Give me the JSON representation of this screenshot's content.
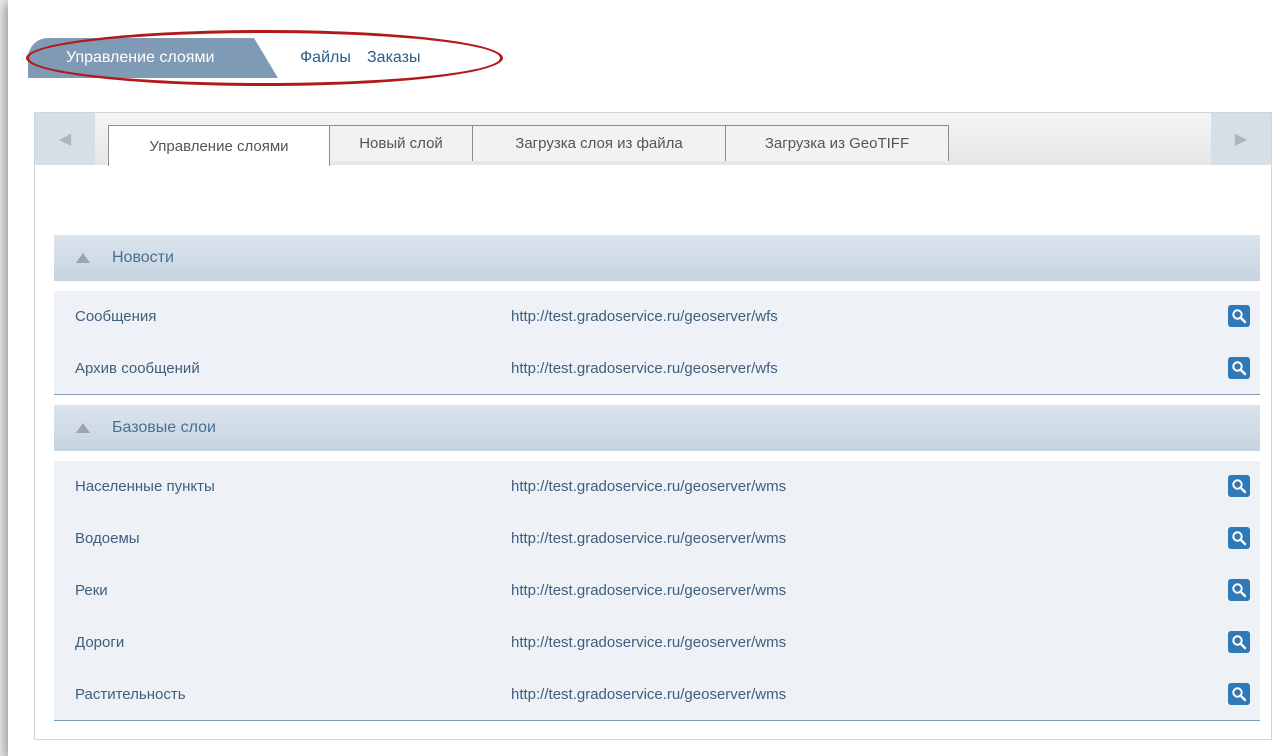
{
  "topnav": {
    "active": "Управление слоями",
    "links": [
      "Файлы",
      "Заказы"
    ]
  },
  "tabs": [
    "Управление слоями",
    "Новый слой",
    "Загрузка слоя из файла",
    "Загрузка из GeoTIFF"
  ],
  "sections": [
    {
      "title": "Новости",
      "rows": [
        {
          "name": "Сообщения",
          "url": "http://test.gradoservice.ru/geoserver/wfs"
        },
        {
          "name": "Архив сообщений",
          "url": "http://test.gradoservice.ru/geoserver/wfs"
        }
      ]
    },
    {
      "title": "Базовые слои",
      "rows": [
        {
          "name": "Населенные пункты",
          "url": "http://test.gradoservice.ru/geoserver/wms"
        },
        {
          "name": "Водоемы",
          "url": "http://test.gradoservice.ru/geoserver/wms"
        },
        {
          "name": "Реки",
          "url": "http://test.gradoservice.ru/geoserver/wms"
        },
        {
          "name": "Дороги",
          "url": "http://test.gradoservice.ru/geoserver/wms"
        },
        {
          "name": "Растительность",
          "url": "http://test.gradoservice.ru/geoserver/wms"
        }
      ]
    }
  ],
  "icons": {
    "tab_prev": "arrow-left-icon",
    "tab_next": "arrow-right-icon",
    "section_toggle": "triangle-up-icon",
    "row_action": "search-icon"
  },
  "colors": {
    "active_tab_bg": "#7f9ab5",
    "highlight_oval": "#b21a1a",
    "link": "#2b5d8a",
    "section_header": "#c6d4e1",
    "row_bg": "#eef2f6",
    "action_button": "#2e79b8"
  }
}
